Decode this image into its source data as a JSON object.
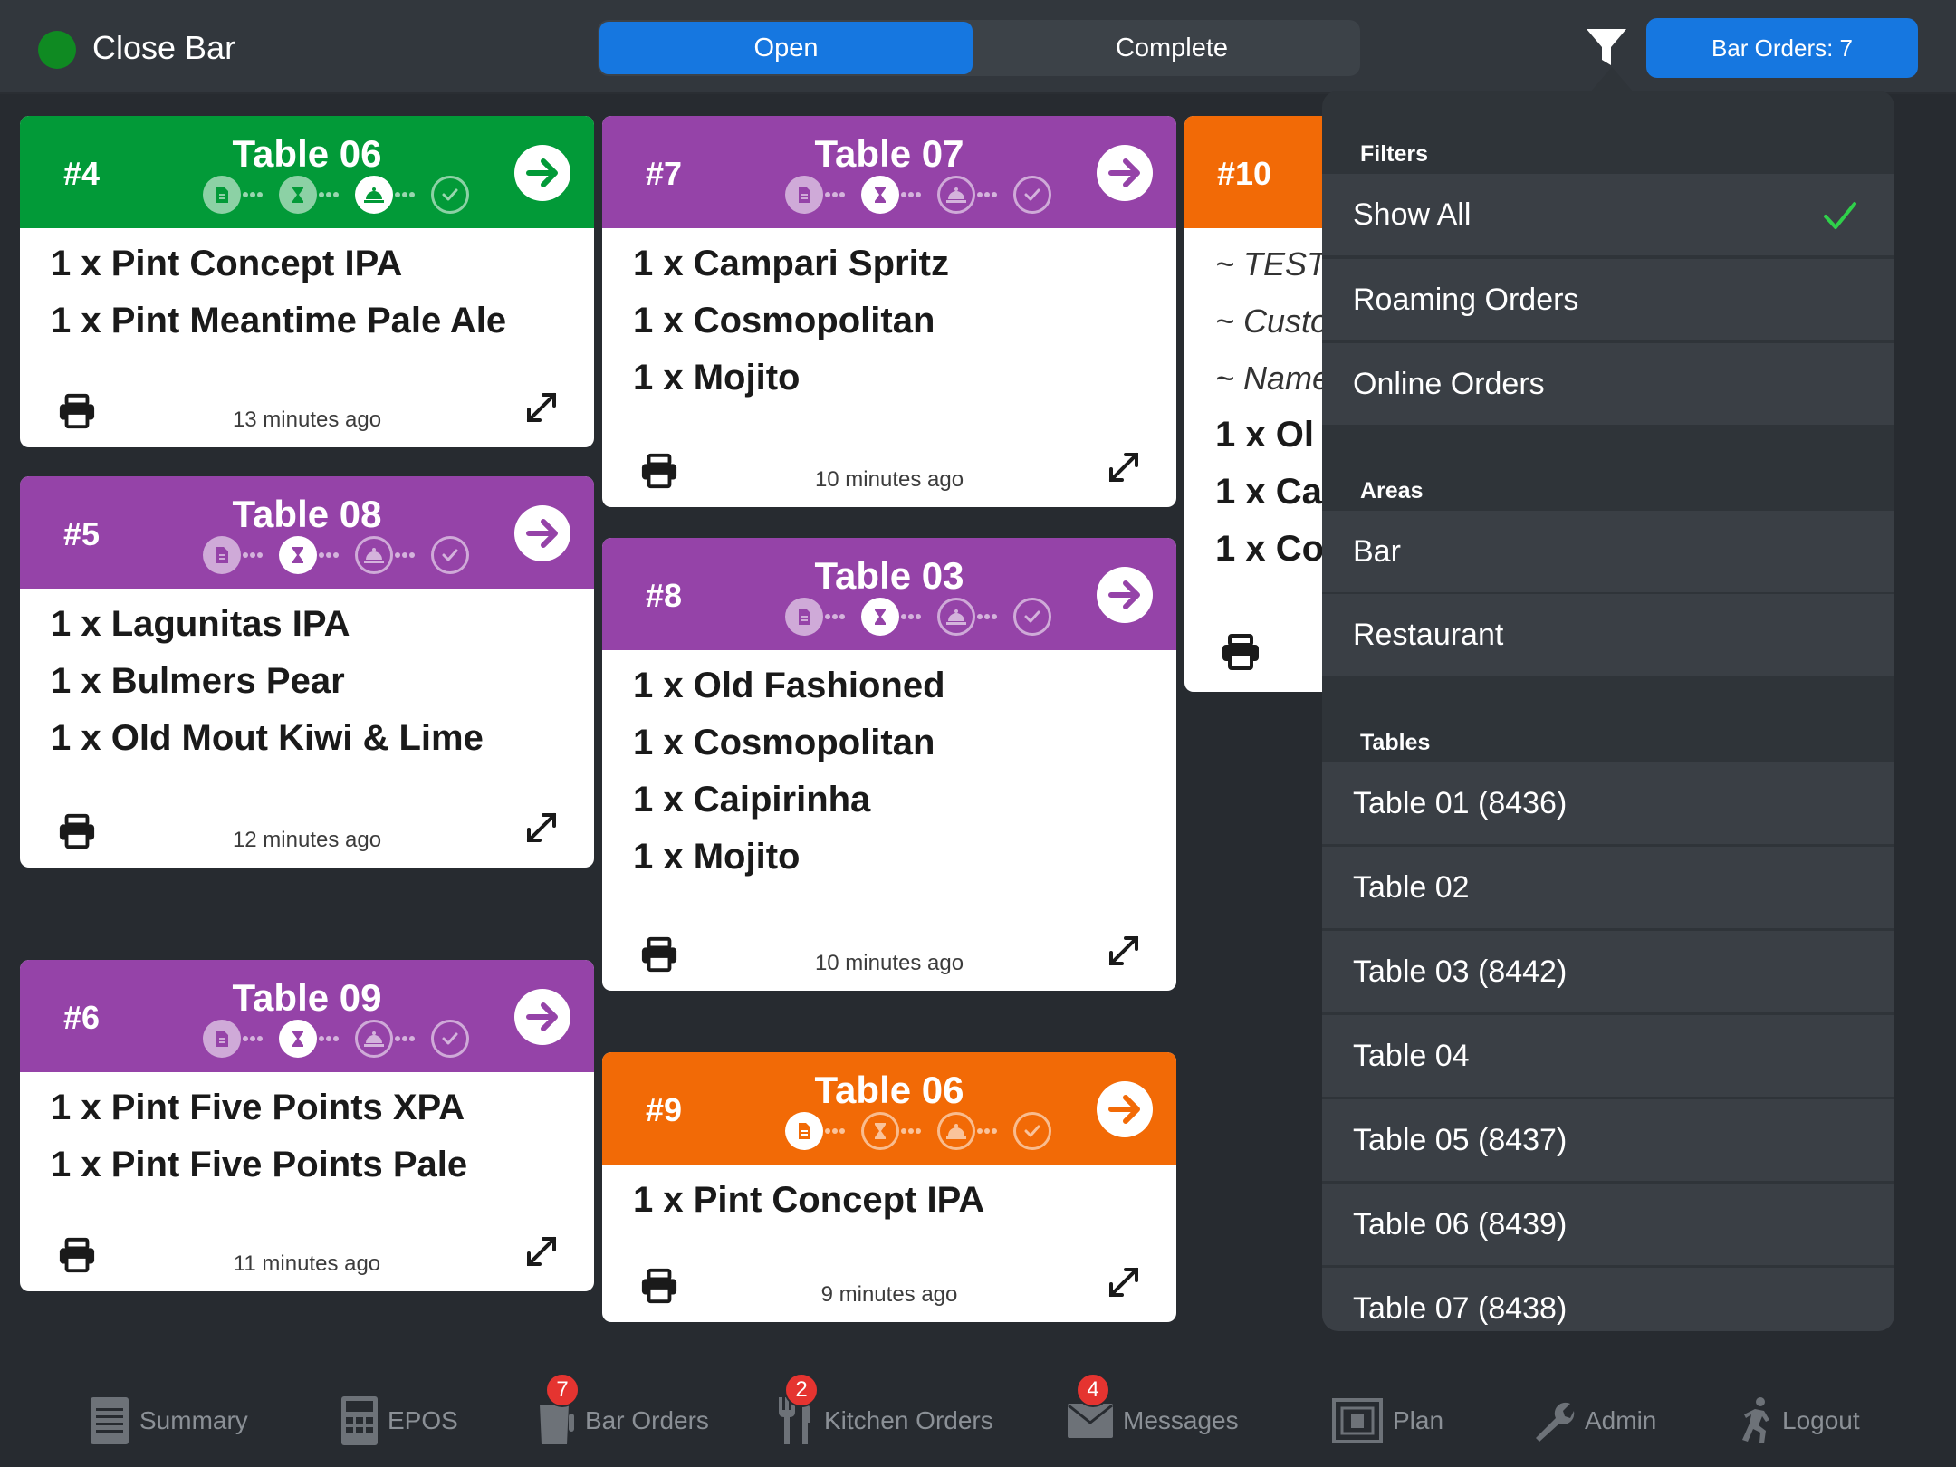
{
  "header": {
    "title": "Close Bar",
    "status_color": "#0f8a22",
    "tabs": [
      "Open",
      "Complete"
    ],
    "active_tab": "Open",
    "bar_orders_label": "Bar Orders: 7"
  },
  "colors": {
    "accent": "#1677e0",
    "green": "#029a38",
    "purple": "#9543a8",
    "orange": "#f26a06"
  },
  "orders": [
    {
      "number": "#4",
      "table": "Table 06",
      "color": "green",
      "step": 3,
      "items": [
        "1 x Pint Concept IPA",
        "1 x Pint Meantime Pale Ale"
      ],
      "time": "13 minutes ago"
    },
    {
      "number": "#5",
      "table": "Table 08",
      "color": "purple",
      "step": 2,
      "items": [
        "1 x Lagunitas IPA",
        "1 x Bulmers Pear",
        "1 x Old Mout Kiwi & Lime"
      ],
      "time": "12 minutes ago"
    },
    {
      "number": "#6",
      "table": "Table 09",
      "color": "purple",
      "step": 2,
      "items": [
        "1 x Pint Five Points XPA",
        "1 x Pint Five Points Pale"
      ],
      "time": "11 minutes ago"
    },
    {
      "number": "#7",
      "table": "Table 07",
      "color": "purple",
      "step": 2,
      "items": [
        "1 x Campari Spritz",
        "1 x Cosmopolitan",
        "1 x Mojito"
      ],
      "time": "10 minutes ago"
    },
    {
      "number": "#8",
      "table": "Table 03",
      "color": "purple",
      "step": 2,
      "items": [
        "1 x Old Fashioned",
        "1 x Cosmopolitan",
        "1 x Caipirinha",
        "1 x Mojito"
      ],
      "time": "10 minutes ago"
    },
    {
      "number": "#9",
      "table": "Table 06",
      "color": "orange",
      "step": 1,
      "items": [
        "1 x Pint Concept IPA"
      ],
      "time": "9 minutes ago"
    }
  ],
  "partial_order": {
    "number": "#10",
    "meta": [
      "~ TEST",
      "~ Custo",
      "~ Name"
    ],
    "items": [
      "1 x Ol",
      "1 x Ca",
      "1 x Co"
    ]
  },
  "step_icons": [
    "document-icon",
    "hourglass-icon",
    "cloche-icon",
    "check-icon"
  ],
  "filters": {
    "filters_title": "Filters",
    "filter_options": [
      "Show All",
      "Roaming Orders",
      "Online Orders"
    ],
    "selected": "Show All",
    "areas_title": "Areas",
    "areas": [
      "Bar",
      "Restaurant"
    ],
    "tables_title": "Tables",
    "tables": [
      "Table 01 (8436)",
      "Table 02",
      "Table 03 (8442)",
      "Table 04",
      "Table 05 (8437)",
      "Table 06 (8439)",
      "Table 07 (8438)"
    ]
  },
  "tabbar": [
    {
      "label": "Summary",
      "icon": "summary-icon"
    },
    {
      "label": "EPOS",
      "icon": "calculator-icon"
    },
    {
      "label": "Bar Orders",
      "icon": "glass-icon",
      "badge": "7"
    },
    {
      "label": "Kitchen Orders",
      "icon": "fork-knife-icon",
      "badge": "2"
    },
    {
      "label": "Messages",
      "icon": "envelope-icon",
      "badge": "4"
    },
    {
      "label": "Plan",
      "icon": "plan-icon"
    },
    {
      "label": "Admin",
      "icon": "wrench-icon"
    },
    {
      "label": "Logout",
      "icon": "running-man-icon"
    }
  ]
}
